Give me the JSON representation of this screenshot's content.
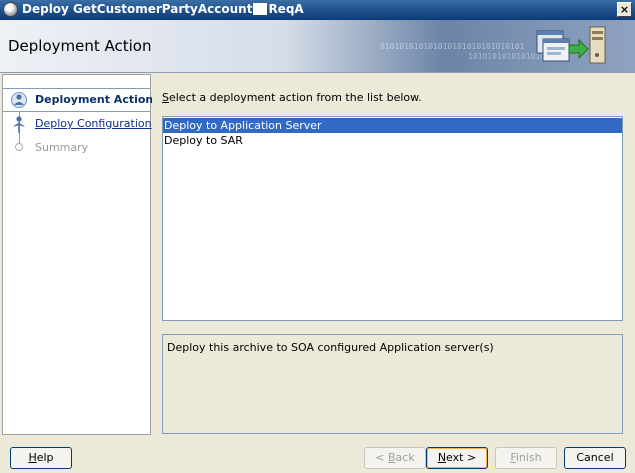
{
  "window": {
    "title_prefix": "Deploy GetCustomerPartyAccount",
    "title_suffix": "ReqA",
    "close_label": "×"
  },
  "header": {
    "title": "Deployment Action",
    "binary_text_1": "010101010101010101010101010101",
    "binary_text_2": "1010101010101010"
  },
  "nav": {
    "items": [
      {
        "label": "Deployment Action",
        "state": "current"
      },
      {
        "label": "Deploy Configuration",
        "state": "link"
      },
      {
        "label": "Summary",
        "state": "disabled"
      }
    ]
  },
  "main": {
    "instruction_prefix": "S",
    "instruction_rest": "elect a deployment action from the list below.",
    "list": [
      {
        "label": "Deploy to Application Server",
        "selected": true
      },
      {
        "label": "Deploy to SAR",
        "selected": false
      }
    ],
    "description": "Deploy this archive to SOA configured Application server(s)"
  },
  "buttons": {
    "help_u": "H",
    "help_rest": "elp",
    "back_pre": "< ",
    "back_u": "B",
    "back_rest": "ack",
    "next_u": "N",
    "next_rest": "ext >",
    "finish_u": "F",
    "finish_rest": "inish",
    "cancel": "Cancel"
  },
  "colors": {
    "selection": "#316ac5",
    "titlebar": "#0b3b78",
    "link": "#0b2d8c"
  }
}
